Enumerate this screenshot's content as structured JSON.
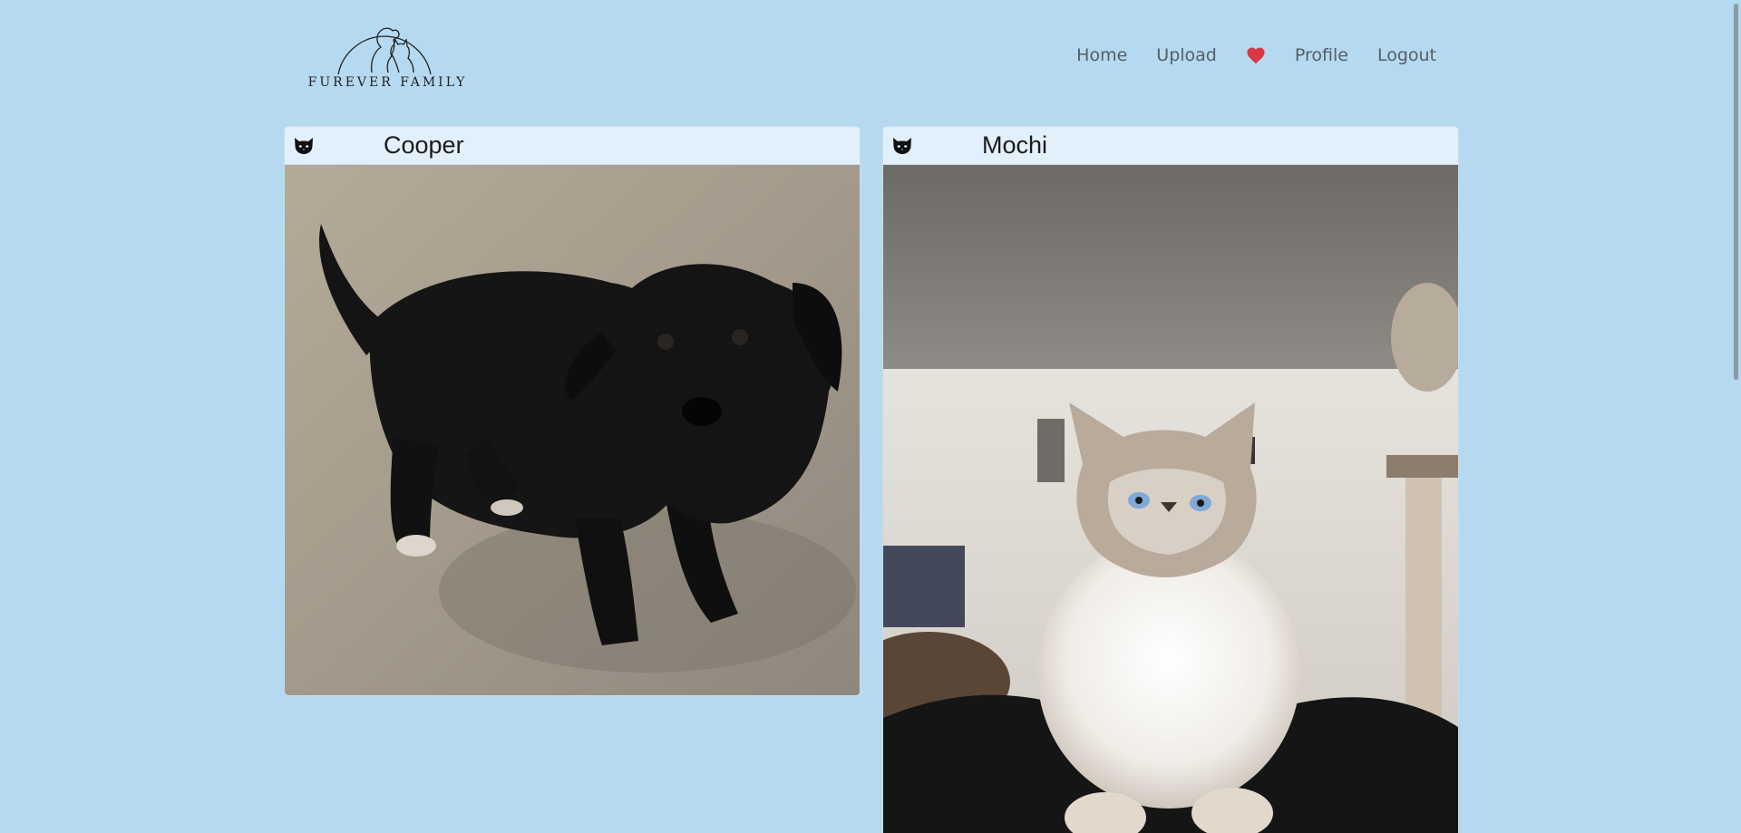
{
  "brand": {
    "name": "FUREVER FAMILY"
  },
  "nav": {
    "home": "Home",
    "upload": "Upload",
    "favorites_icon": "heart-icon",
    "profile": "Profile",
    "logout": "Logout"
  },
  "colors": {
    "background": "#b5d9f0",
    "card_header": "#e2f0fb",
    "heart": "#dc3545"
  },
  "pets": [
    {
      "name": "Cooper",
      "icon": "cat-icon",
      "photo": "black-dog-photo"
    },
    {
      "name": "Mochi",
      "icon": "cat-icon",
      "photo": "ragdoll-cat-photo"
    }
  ]
}
